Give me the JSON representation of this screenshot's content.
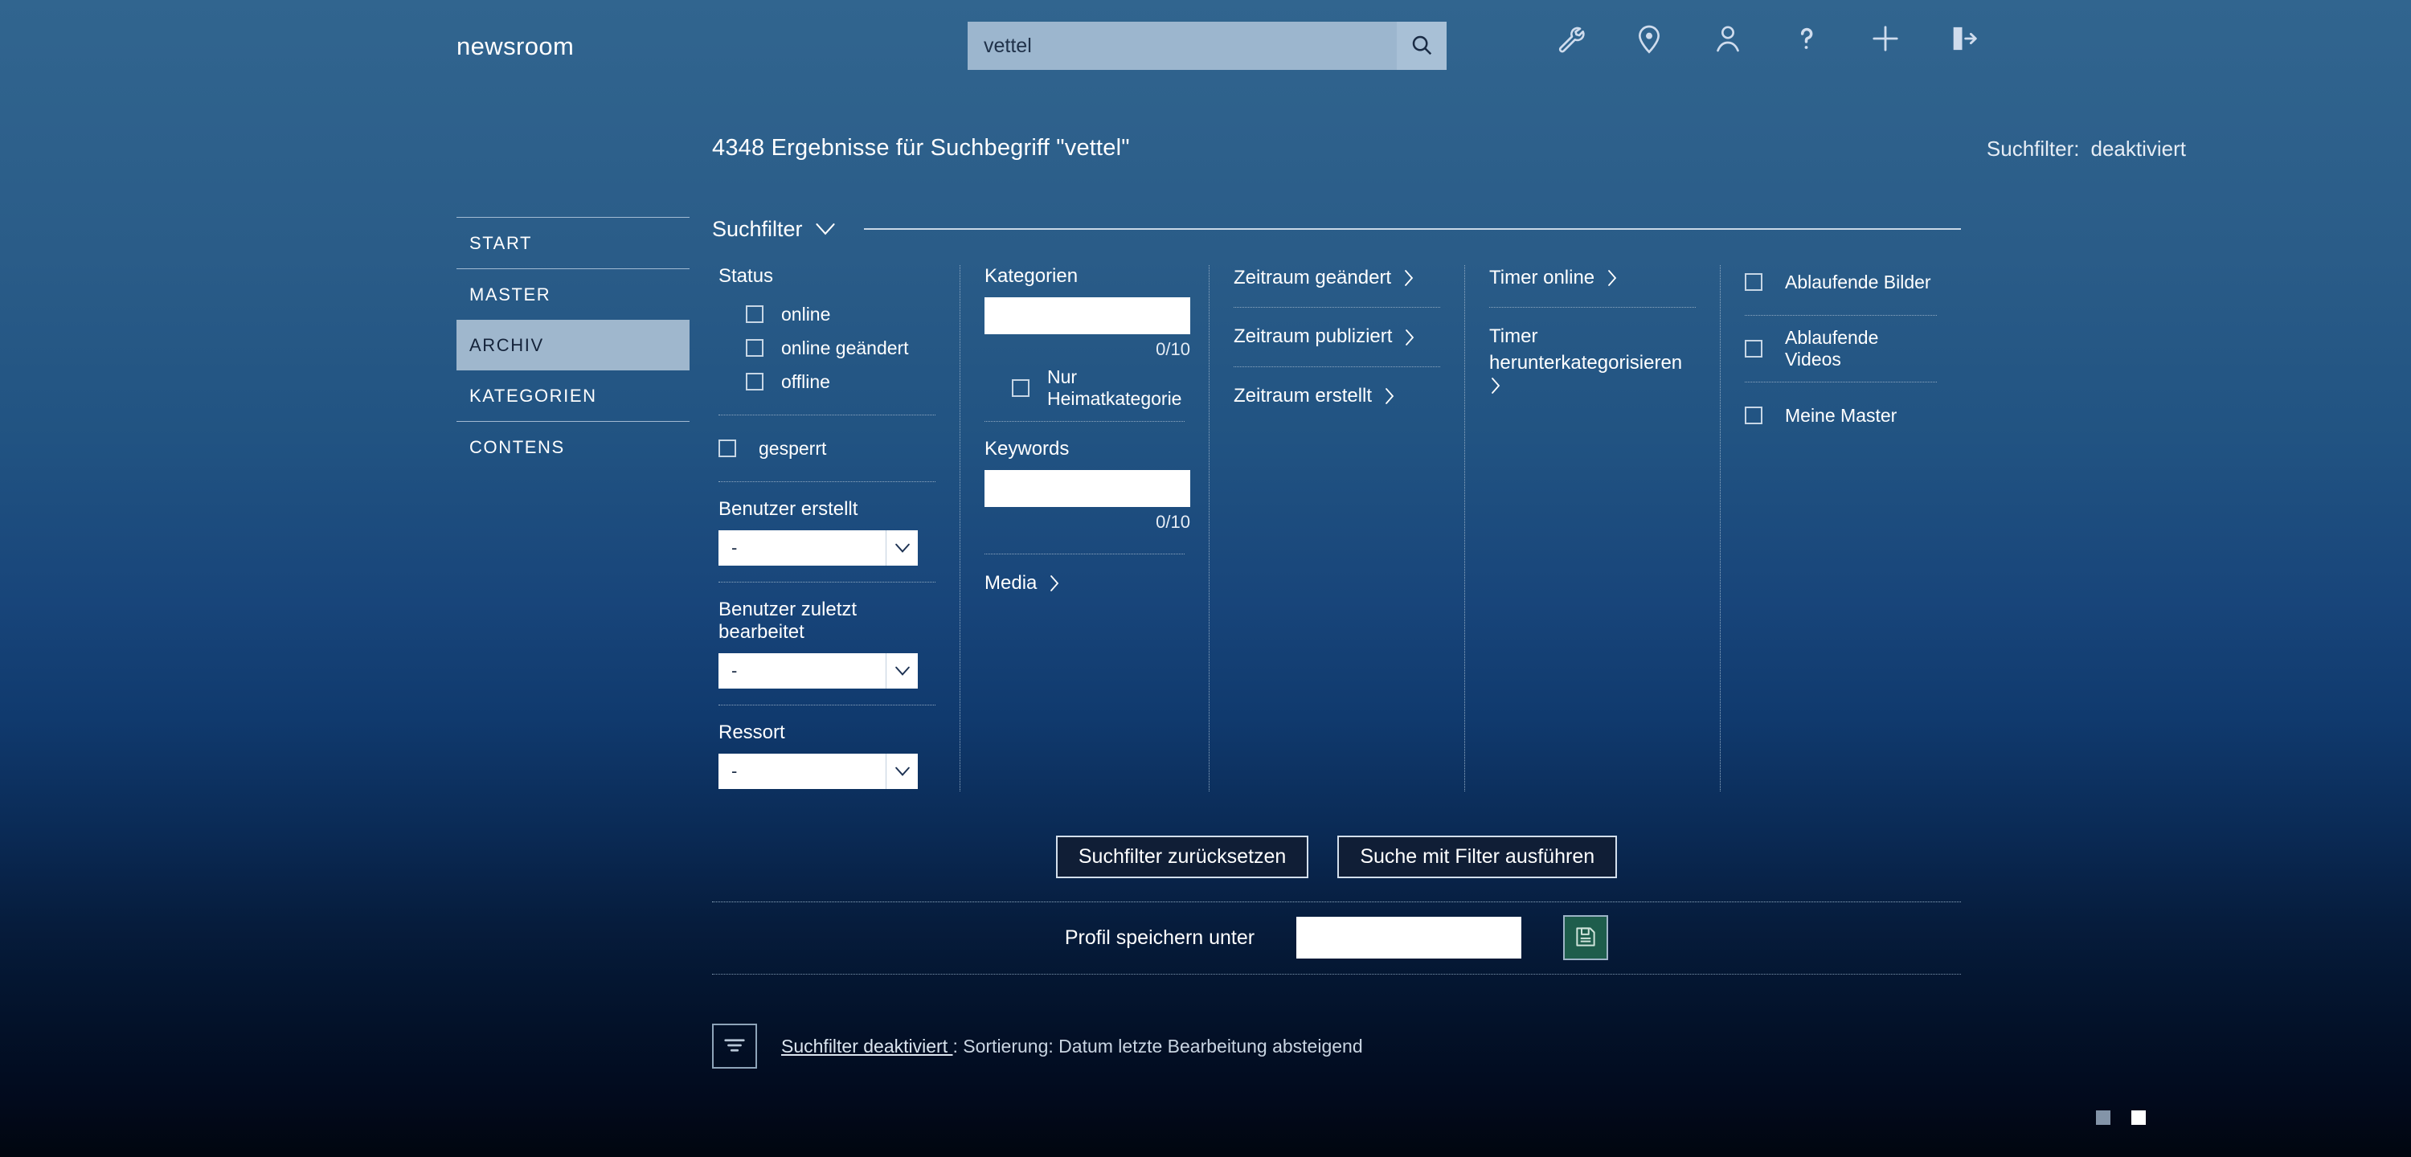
{
  "header": {
    "brand": "newsroom",
    "search": {
      "value": "vettel",
      "placeholder": "",
      "icon": "search-icon",
      "button_name": "search-button"
    },
    "icons": [
      {
        "name": "wrench-icon",
        "label": "Werkzeuge"
      },
      {
        "name": "location-pin-icon",
        "label": "Standort"
      },
      {
        "name": "user-icon",
        "label": "Benutzer"
      },
      {
        "name": "help-icon",
        "label": "Hilfe"
      },
      {
        "name": "plus-icon",
        "label": "Neu"
      },
      {
        "name": "logout-icon",
        "label": "Abmelden"
      }
    ]
  },
  "results": {
    "summary": "4348 Ergebnisse für Suchbegriff \"vettel\"",
    "filter_label": "Suchfilter:",
    "filter_state": "deaktiviert"
  },
  "sidebar": {
    "items": [
      {
        "label": "START",
        "active": false
      },
      {
        "label": "MASTER",
        "active": false
      },
      {
        "label": "ARCHIV",
        "active": true
      },
      {
        "label": "KATEGORIEN",
        "active": false
      },
      {
        "label": "CONTENS",
        "active": false
      }
    ]
  },
  "panel": {
    "title": "Suchfilter",
    "toggle_icon": "chevron-down-icon",
    "col1": {
      "status_title": "Status",
      "status_options": [
        {
          "label": "online",
          "checked": false
        },
        {
          "label": "online geändert",
          "checked": false
        },
        {
          "label": "offline",
          "checked": false
        }
      ],
      "locked": {
        "label": "gesperrt",
        "checked": false
      },
      "user_created_label": "Benutzer erstellt",
      "user_created_value": "-",
      "user_edited_label": "Benutzer zuletzt bearbeitet",
      "user_edited_value": "-",
      "ressort_label": "Ressort",
      "ressort_value": "-"
    },
    "col2": {
      "categories_label": "Kategorien",
      "categories_value": "",
      "categories_counter": "0/10",
      "home_category": {
        "label": "Nur Heimatkategorie",
        "checked": false
      },
      "keywords_label": "Keywords",
      "keywords_value": "",
      "keywords_counter": "0/10",
      "media_label": "Media"
    },
    "col3": {
      "links": [
        {
          "label": "Zeitraum geändert"
        },
        {
          "label": "Zeitraum publiziert"
        },
        {
          "label": "Zeitraum erstellt"
        }
      ]
    },
    "col4": {
      "links": [
        {
          "label": "Timer online"
        },
        {
          "label": "Timer herunterkategorisieren"
        }
      ]
    },
    "col5": {
      "options": [
        {
          "label": "Ablaufende Bilder",
          "checked": false
        },
        {
          "label": "Ablaufende Videos",
          "checked": false
        },
        {
          "label": "Meine Master",
          "checked": false
        }
      ]
    }
  },
  "actions": {
    "reset_label": "Suchfilter zurücksetzen",
    "run_label": "Suche mit Filter ausführen"
  },
  "profile": {
    "label": "Profil speichern unter",
    "value": "",
    "placeholder": "",
    "save_icon": "save-disk-icon"
  },
  "footer": {
    "filter_icon": "filter-sort-icon",
    "link_text": "Suchfilter deaktiviert ",
    "sort_text": ": Sortierung: Datum letzte Bearbeitung absteigend",
    "view_modes": [
      {
        "name": "view-mode-list",
        "active": false
      },
      {
        "name": "view-mode-grid",
        "active": true
      }
    ]
  },
  "colors": {
    "bg_top": "#31658f",
    "bg_bottom": "#01060f",
    "accent_active": "#9fb7cd",
    "save_green": "#1e5d4c",
    "search_field": "#9cb6ce"
  }
}
